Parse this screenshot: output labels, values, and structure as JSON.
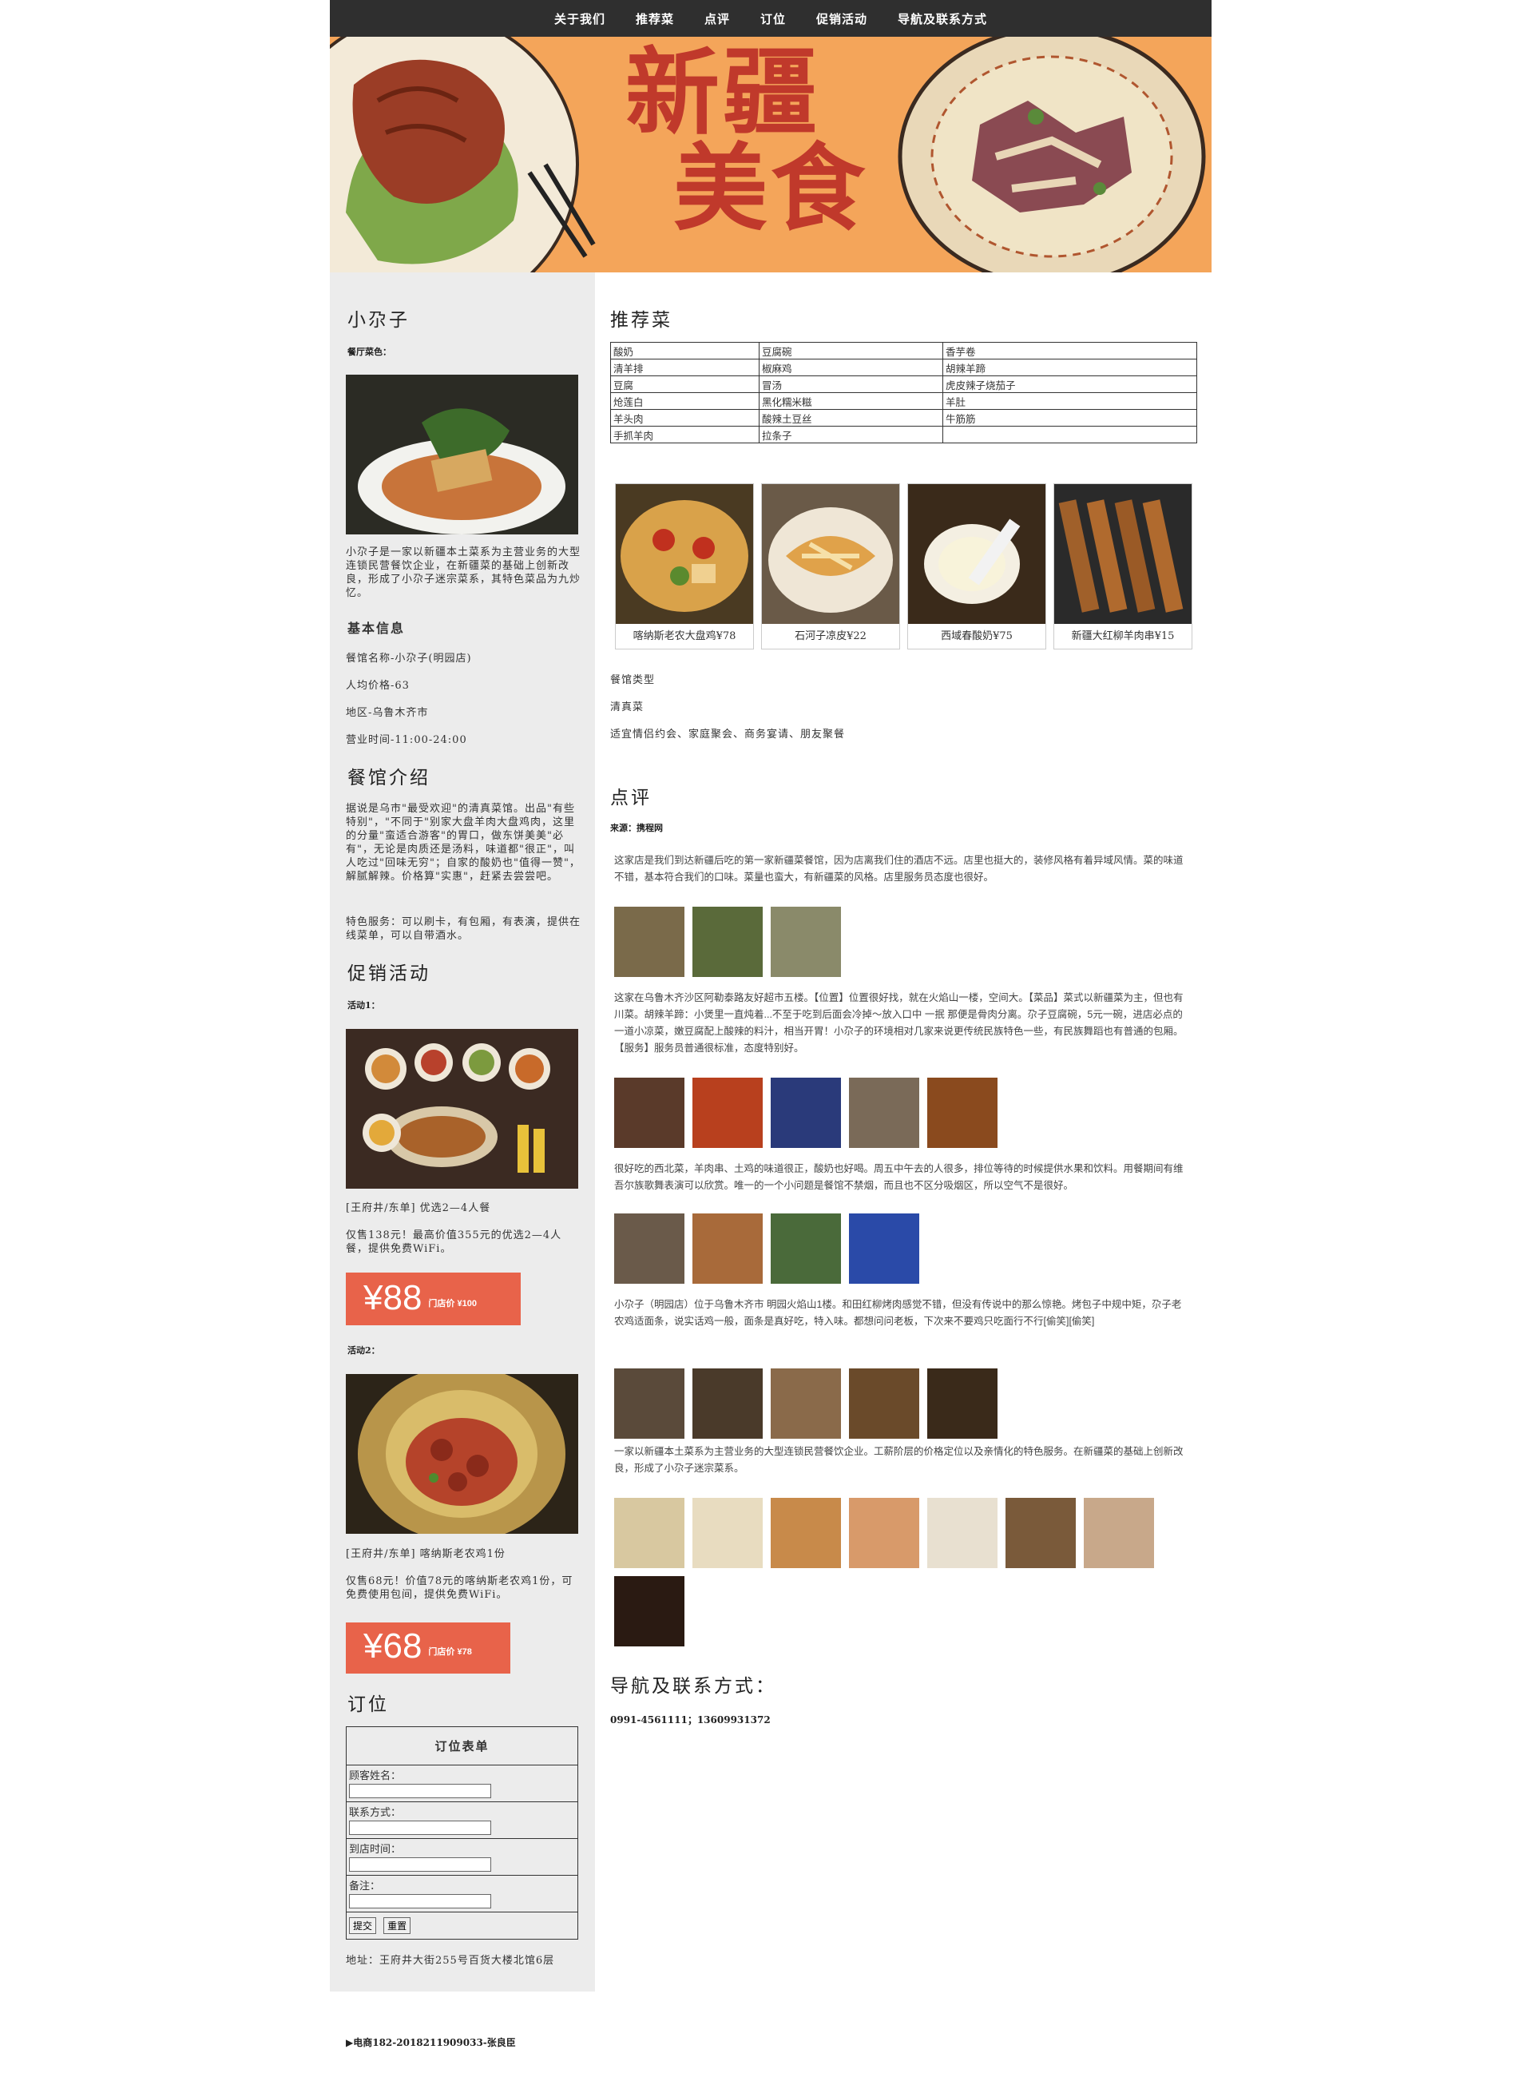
{
  "nav": [
    "关于我们",
    "推荐菜",
    "点评",
    "订位",
    "促销活动",
    "导航及联系方式"
  ],
  "banner": {
    "line1": "新疆",
    "line2": "美食"
  },
  "sidebar": {
    "title": "小尕子",
    "dish_label": "餐厅菜色：",
    "intro": "小尕子是一家以新疆本土菜系为主营业务的大型连锁民营餐饮企业，在新疆菜的基础上创新改良，形成了小尕子迷宗菜系，其特色菜品为九炒忆。",
    "basic_title": "基本信息",
    "basic": [
      "餐馆名称-小尕子(明园店)",
      "人均价格-63",
      "地区-乌鲁木齐市",
      "营业时间-11:00-24:00"
    ],
    "about_title": "餐馆介绍",
    "about": "据说是乌市\"最受欢迎\"的清真菜馆。出品\"有些特别\"，\"不同于\"别家大盘羊肉大盘鸡肉，这里的分量\"蛮适合游客\"的胃口，做东饼美美\"必有\"，无论是肉质还是汤料，味道都\"很正\"，叫人吃过\"回味无穷\"；自家的酸奶也\"值得一赞\"，解腻解辣。价格算\"实惠\"，赶紧去尝尝吧。",
    "service": "特色服务：可以刷卡，有包厢，有表演，提供在线菜单，可以自带酒水。",
    "promo_title": "促销活动",
    "promo1": {
      "label": "活动1：",
      "name": "[王府井/东单] 优选2—4人餐",
      "desc": "仅售138元！最高价值355元的优选2—4人餐，提供免费WiFi。",
      "price": "¥88",
      "orig": "门店价 ¥100"
    },
    "promo2": {
      "label": "活动2：",
      "name": "[王府井/东单] 喀纳斯老农鸡1份",
      "desc": "仅售68元！价值78元的喀纳斯老农鸡1份，可免费使用包间，提供免费WiFi。",
      "price": "¥68",
      "orig": "门店价 ¥78"
    },
    "booking_title": "订位",
    "form": {
      "title": "订位表单",
      "fields": [
        "顾客姓名：",
        "联系方式：",
        "到店时间：",
        "备注："
      ],
      "submit": "提交",
      "reset": "重置"
    },
    "address": "地址：王府井大街255号百货大楼北馆6层"
  },
  "main": {
    "rec_title": "推荐菜",
    "rec_table": [
      [
        "酸奶",
        "豆腐碗",
        "香芋卷"
      ],
      [
        "清羊排",
        "椒麻鸡",
        "胡辣羊蹄"
      ],
      [
        "豆腐",
        "冒汤",
        "虎皮辣子烧茄子"
      ],
      [
        "炝莲白",
        "黑化糯米糍",
        "羊肚"
      ],
      [
        "羊头肉",
        "酸辣土豆丝",
        "牛筋筋"
      ],
      [
        "手抓羊肉",
        "拉条子",
        ""
      ]
    ],
    "dishes": [
      "喀纳斯老农大盘鸡¥78",
      "石河子凉皮¥22",
      "西域春酸奶¥75",
      "新疆大红柳羊肉串¥15"
    ],
    "type_lines": [
      "餐馆类型",
      "清真菜",
      "适宜情侣约会、家庭聚会、商务宴请、朋友聚餐"
    ],
    "review_title": "点评",
    "review_source": "来源：携程网",
    "reviews": [
      "这家店是我们到达新疆后吃的第一家新疆菜餐馆，因为店离我们住的酒店不远。店里也挺大的，装修风格有着异域风情。菜的味道不错，基本符合我们的口味。菜量也蛮大，有新疆菜的风格。店里服务员态度也很好。",
      "这家在乌鲁木齐沙区阿勒泰路友好超市五楼。【位置】位置很好找，就在火焰山一楼，空间大。【菜品】菜式以新疆菜为主，但也有川菜。胡辣羊蹄：小煲里一直炖着...不至于吃到后面会冷掉～放入口中 一抿 那便是骨肉分离。尕子豆腐碗，5元一碗，进店必点的一道小凉菜，嫩豆腐配上酸辣的料汁，相当开胃！小尕子的环境相对几家来说更传统民族特色一些，有民族舞蹈也有普通的包厢。【服务】服务员普通很标准，态度特别好。",
      "很好吃的西北菜，羊肉串、土鸡的味道很正，酸奶也好喝。周五中午去的人很多，排位等待的时候提供水果和饮料。用餐期间有维吾尔族歌舞表演可以欣赏。唯一的一个小问题是餐馆不禁烟，而且也不区分吸烟区，所以空气不是很好。",
      "小尕子（明园店）位于乌鲁木齐市 明园火焰山1楼。和田红柳烤肉感觉不错，但没有传说中的那么惊艳。烤包子中规中矩，尕子老农鸡适面条，说实话鸡一般，面条是真好吃，特入味。都想问问老板，下次来不要鸡只吃面行不行[偷笑][偷笑]",
      "一家以新疆本土菜系为主营业务的大型连锁民营餐饮企业。工薪阶层的价格定位以及亲情化的特色服务。在新疆菜的基础上创新改良，形成了小尕子迷宗菜系。"
    ],
    "contact_title": "导航及联系方式：",
    "contact": "0991-4561111；13609931372"
  },
  "footer": "▶电商182-2018211909033-张良臣"
}
